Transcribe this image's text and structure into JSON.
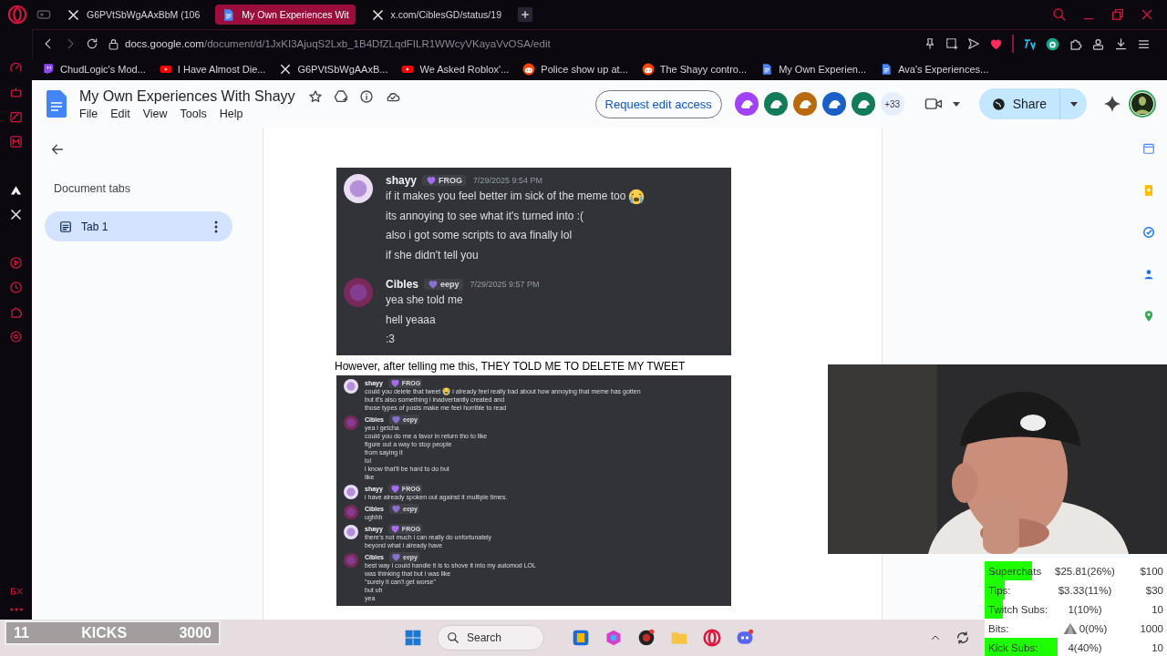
{
  "browser": {
    "tabs": [
      {
        "label": "G6PVtSbWgAAxBbM (106",
        "kind": "x",
        "selected": false
      },
      {
        "label": "My Own Experiences Wit",
        "kind": "docs",
        "selected": true
      },
      {
        "label": "x.com/CiblesGD/status/19",
        "kind": "x",
        "selected": false
      }
    ],
    "url": {
      "host": "docs.google.com",
      "path": "/document/d/1JxKI3AjuqS2Lxb_1B4DfZLqdFILR1WWcyVKayaVvOSA/edit"
    },
    "bookmarks": [
      {
        "label": "ChudLogic's Mod...",
        "kind": "twitch"
      },
      {
        "label": "I Have Almost Die...",
        "kind": "youtube"
      },
      {
        "label": "G6PVtSbWgAAxB...",
        "kind": "x"
      },
      {
        "label": "We Asked Roblox'...",
        "kind": "youtube"
      },
      {
        "label": "Police show up at...",
        "kind": "reddit"
      },
      {
        "label": "The Shayy contro...",
        "kind": "reddit"
      },
      {
        "label": "My Own Experien...",
        "kind": "docs"
      },
      {
        "label": "Ava's Experiences...",
        "kind": "docs"
      }
    ]
  },
  "doc": {
    "title": "My Own Experiences With Shayy",
    "menu": [
      "File",
      "Edit",
      "View",
      "Tools",
      "Help"
    ],
    "request_button": "Request edit access",
    "collaborators": [
      {
        "color": "#a142f4"
      },
      {
        "color": "#137a5a"
      },
      {
        "color": "#b86a0c"
      },
      {
        "color": "#1a5fc8"
      },
      {
        "color": "#137a5a"
      }
    ],
    "more_collaborators": "+33",
    "share_button": "Share",
    "tabs_heading": "Document tabs",
    "doc_tabs": [
      {
        "label": "Tab 1",
        "selected": true
      }
    ],
    "content": [
      {
        "kind": "chat",
        "messages": [
          {
            "author": "shayy",
            "color": "#e9ddf5",
            "badge": {
              "label": "FROG",
              "color": "#a56cf0"
            },
            "time": "7/29/2025 9:54 PM",
            "lines": [
              {
                "before": "if it makes you feel better im sick of the meme too"
              },
              "its annoying to see what it's turned into :(",
              "also i got some scripts to ava finally lol",
              "if she didn't tell you"
            ]
          },
          {
            "author": "Cibles",
            "color": "#7a2a5a",
            "badge": {
              "label": "eepy",
              "color": "#8a6fd0"
            },
            "time": "7/29/2025 9:57 PM",
            "lines": [
              "yea she told me",
              "hell yeaaa",
              ":3"
            ]
          }
        ]
      },
      {
        "kind": "text",
        "text": "However, after telling me this, THEY TOLD ME TO DELETE MY TWEET"
      },
      {
        "kind": "compact",
        "messages": [
          {
            "author": "shayy",
            "color": "#e9ddf5",
            "badge": {
              "label": "FROG",
              "color": "#a56cf0"
            },
            "lines": [
              {
                "before": "could you delete that tweet",
                "after": "i already feel really bad about how annoying that meme has gotten"
              },
              "but it's also something i inadvertantly created and",
              "those types of posts make me feel horrible to read"
            ]
          },
          {
            "author": "Cibles",
            "color": "#7a2a5a",
            "badge": {
              "label": "eepy",
              "color": "#8a6fd0"
            },
            "lines": [
              "yea i getcha",
              "could you do me a favor in return tho to like",
              "figure out a way to stop people",
              "from saying it",
              "lol",
              "i know that'll be hard to do but",
              "like"
            ]
          },
          {
            "author": "shayy",
            "color": "#e9ddf5",
            "badge": {
              "label": "FROG",
              "color": "#a56cf0"
            },
            "lines": [
              "i have already spoken out against it multiple times."
            ]
          },
          {
            "author": "Cibles",
            "color": "#7a2a5a",
            "badge": {
              "label": "eepy",
              "color": "#8a6fd0"
            },
            "lines": [
              "ughhh"
            ]
          },
          {
            "author": "shayy",
            "color": "#e9ddf5",
            "badge": {
              "label": "FROG",
              "color": "#a56cf0"
            },
            "lines": [
              "there's not much i can really do unfortunately",
              "beyond what i already have"
            ]
          },
          {
            "author": "Cibles",
            "color": "#7a2a5a",
            "badge": {
              "label": "eepy",
              "color": "#8a6fd0"
            },
            "lines": [
              "best way i could handle it is to shove it into my automod LOL",
              "was thinking that but i was like",
              "\"surely it can't get worse\"",
              "but uh",
              "yea"
            ]
          }
        ]
      }
    ]
  },
  "taskbar": {
    "search_placeholder": "Search"
  },
  "overlay": {
    "kicks": {
      "count": "11",
      "label": "KICKS",
      "goal": "3000"
    },
    "goals": [
      {
        "label": "Superchats",
        "value": "$25.81(26%)",
        "target": "$100",
        "level": 0.26
      },
      {
        "label": "Tips:",
        "value": "$3.33(11%)",
        "target": "$30",
        "level": 0.11
      },
      {
        "label": "Twitch Subs:",
        "value": "1(10%)",
        "target": "10",
        "level": 0.1
      },
      {
        "label": "Bits:",
        "value": "0(0%)",
        "target": "1000",
        "level": 0,
        "kind": "bits"
      },
      {
        "label": "Kick Subs:",
        "value": "4(40%)",
        "target": "10",
        "level": 0.4
      }
    ]
  }
}
